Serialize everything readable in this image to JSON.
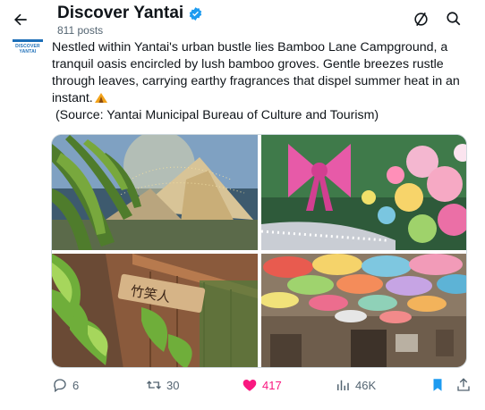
{
  "header": {
    "title": "Discover Yantai",
    "subtitle": "811 posts",
    "back_icon": "arrow-left-icon",
    "refresh_icon": "refresh-circle-icon",
    "search_icon": "search-icon"
  },
  "avatar": {
    "logo_text": "DISCOVER YANTAI"
  },
  "post": {
    "text": "Nestled within Yantai's urban bustle lies Bamboo Lane Campground, a tranquil oasis encircled by lush bamboo groves. Gentle breezes rustle through leaves, carrying earthy fragrances that dispel summer heat in an instant.",
    "source": " (Source: Yantai Municipal Bureau of Culture and Tourism)",
    "emoji_icon": "tent-icon"
  },
  "media": {
    "photos": [
      "bamboo-tent-photo",
      "pink-bow-garden-photo",
      "wooden-sign-photo",
      "umbrella-ceiling-photo"
    ]
  },
  "actions": {
    "replies": "6",
    "reposts": "30",
    "likes": "417",
    "views": "46K"
  },
  "colors": {
    "accent": "#1d9bf0",
    "like": "#f91880",
    "muted": "#536471"
  }
}
